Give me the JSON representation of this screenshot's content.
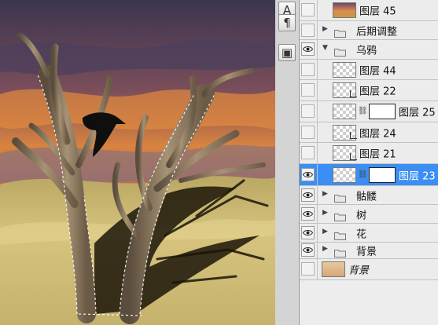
{
  "toolbar": {
    "tools": [
      {
        "icon": "character-panel-icon",
        "glyph": "A"
      },
      {
        "icon": "paragraph-icon",
        "glyph": "¶"
      },
      {
        "icon": "navigator-icon",
        "glyph": "▣"
      }
    ]
  },
  "layers": [
    {
      "name": "图层 45",
      "type": "layer",
      "visible": false,
      "thumb": "sky"
    },
    {
      "name": "后期调整",
      "type": "group",
      "visible": false,
      "expanded": false
    },
    {
      "name": "乌鸦",
      "type": "group",
      "visible": true,
      "expanded": true
    },
    {
      "name": "图层 44",
      "type": "layer",
      "visible": false,
      "thumb": "transparent"
    },
    {
      "name": "图层 22",
      "type": "layer",
      "visible": false,
      "thumb": "transparent",
      "clipped": true
    },
    {
      "name": "图层 25",
      "type": "layer",
      "visible": false,
      "thumb": "transparent",
      "mask": true
    },
    {
      "name": "图层 24",
      "type": "layer",
      "visible": false,
      "thumb": "transparent",
      "clipped": true
    },
    {
      "name": "图层 21",
      "type": "layer",
      "visible": false,
      "thumb": "transparent",
      "clipped": true
    },
    {
      "name": "图层 23",
      "type": "layer",
      "visible": true,
      "thumb": "transparent",
      "mask": true,
      "selected": true
    },
    {
      "name": "骷髅",
      "type": "group",
      "visible": true,
      "expanded": false
    },
    {
      "name": "树",
      "type": "group",
      "visible": true,
      "expanded": false
    },
    {
      "name": "花",
      "type": "group",
      "visible": true,
      "expanded": false
    },
    {
      "name": "背景",
      "type": "group",
      "visible": true,
      "expanded": false
    },
    {
      "name": "背景",
      "type": "background",
      "visible": false,
      "thumb": "sand"
    }
  ],
  "colors": {
    "selection": "#3b8ef3",
    "panel": "#ececec",
    "sky_top": "#3b3550",
    "sky_glow": "#e9833e",
    "sand": "#c9b46a"
  }
}
